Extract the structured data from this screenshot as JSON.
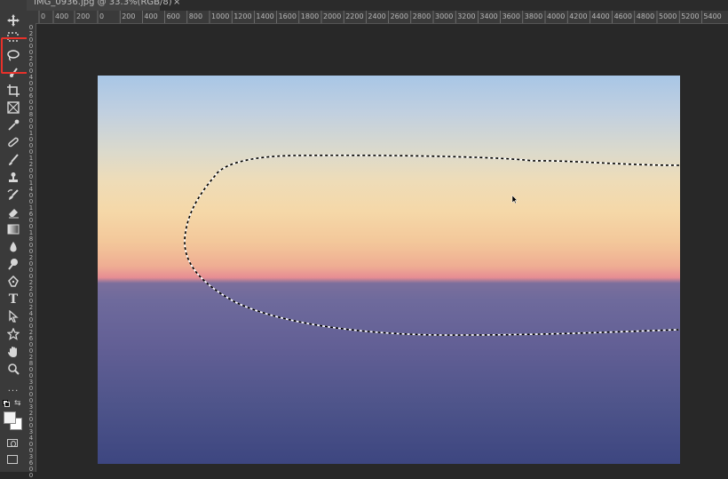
{
  "document_tab": {
    "title": "IMG_0936.jpg @ 33.3%(RGB/8)",
    "close_symbol": "×"
  },
  "horizontal_ruler": {
    "ticks": [
      "0",
      "400",
      "200",
      "0",
      "200",
      "400",
      "600",
      "800",
      "1000",
      "1200",
      "1400",
      "1600",
      "1800",
      "2000",
      "2200",
      "2400",
      "2600",
      "2800",
      "3000",
      "3200",
      "3400",
      "3600",
      "3800",
      "4000",
      "4200",
      "4400",
      "4600",
      "4800",
      "5000",
      "5200",
      "5400"
    ]
  },
  "vertical_ruler": {
    "ticks": [
      "0",
      "2",
      "0",
      "0",
      "0",
      "2",
      "0",
      "0",
      "4",
      "0",
      "0",
      "6",
      "0",
      "0",
      "8",
      "0",
      "0",
      "1",
      "0",
      "0",
      "0",
      "1",
      "2",
      "0",
      "0",
      "1",
      "4",
      "0",
      "0",
      "1",
      "6",
      "0",
      "0",
      "1",
      "8",
      "0",
      "0",
      "2",
      "0",
      "0",
      "0",
      "2",
      "2",
      "0",
      "0",
      "2",
      "4",
      "0",
      "0",
      "2",
      "6",
      "0",
      "0",
      "2",
      "8",
      "0",
      "0",
      "3",
      "0",
      "0",
      "0",
      "3",
      "2",
      "0",
      "0",
      "3",
      "4",
      "0",
      "0",
      "3",
      "6",
      "0",
      "0"
    ]
  },
  "toolbar": {
    "tools": [
      {
        "name": "move-tool",
        "icon": "move-icon"
      },
      {
        "name": "marquee-tool",
        "icon": "marquee-icon"
      },
      {
        "name": "lasso-tool",
        "icon": "lasso-icon",
        "selected": true
      },
      {
        "name": "quick-selection-tool",
        "icon": "brush-select-icon"
      },
      {
        "name": "crop-tool",
        "icon": "crop-icon"
      },
      {
        "name": "frame-tool",
        "icon": "frame-icon"
      },
      {
        "name": "eyedropper-tool",
        "icon": "eyedropper-icon"
      },
      {
        "name": "healing-brush-tool",
        "icon": "bandage-icon"
      },
      {
        "name": "brush-tool",
        "icon": "brush-icon"
      },
      {
        "name": "clone-stamp-tool",
        "icon": "stamp-icon"
      },
      {
        "name": "history-brush-tool",
        "icon": "history-brush-icon"
      },
      {
        "name": "eraser-tool",
        "icon": "eraser-icon"
      },
      {
        "name": "gradient-tool",
        "icon": "gradient-icon"
      },
      {
        "name": "blur-tool",
        "icon": "drop-icon"
      },
      {
        "name": "dodge-tool",
        "icon": "dodge-icon"
      },
      {
        "name": "pen-tool",
        "icon": "pen-icon"
      },
      {
        "name": "type-tool",
        "icon": "type-icon"
      },
      {
        "name": "path-selection-tool",
        "icon": "arrow-icon"
      },
      {
        "name": "shape-tool",
        "icon": "star-icon"
      },
      {
        "name": "hand-tool",
        "icon": "hand-icon"
      },
      {
        "name": "zoom-tool",
        "icon": "zoom-icon"
      },
      {
        "name": "more-tools",
        "icon": "ellipsis-icon"
      }
    ],
    "type_label": "T",
    "ellipsis_label": "..."
  },
  "colors": {
    "highlight": "#e8312a",
    "toolbar_bg": "#3a3a3a",
    "workspace_bg": "#282828"
  }
}
